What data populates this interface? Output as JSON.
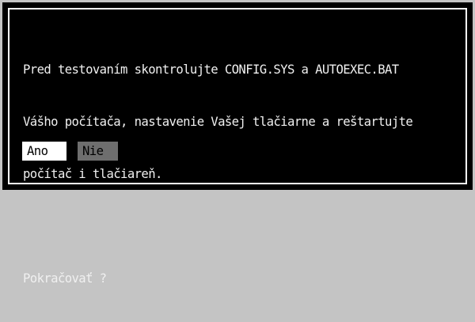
{
  "dialog": {
    "message_lines": [
      "Pred testovaním skontrolujte CONFIG.SYS a AUTOEXEC.BAT",
      "Vášho počítača, nastavenie Vašej tlačiarne a reštartujte",
      "počítač i tlačiareň."
    ],
    "question": "Pokračovať ?",
    "buttons": {
      "yes_label": "Ano",
      "no_label": "Nie"
    }
  },
  "colors": {
    "page_background": "#c4c4c4",
    "dialog_background": "#000000",
    "dialog_border": "#ffffff",
    "text": "#f0f0f0",
    "yes_button_bg": "#ffffff",
    "no_button_bg": "#6e6e6e"
  }
}
